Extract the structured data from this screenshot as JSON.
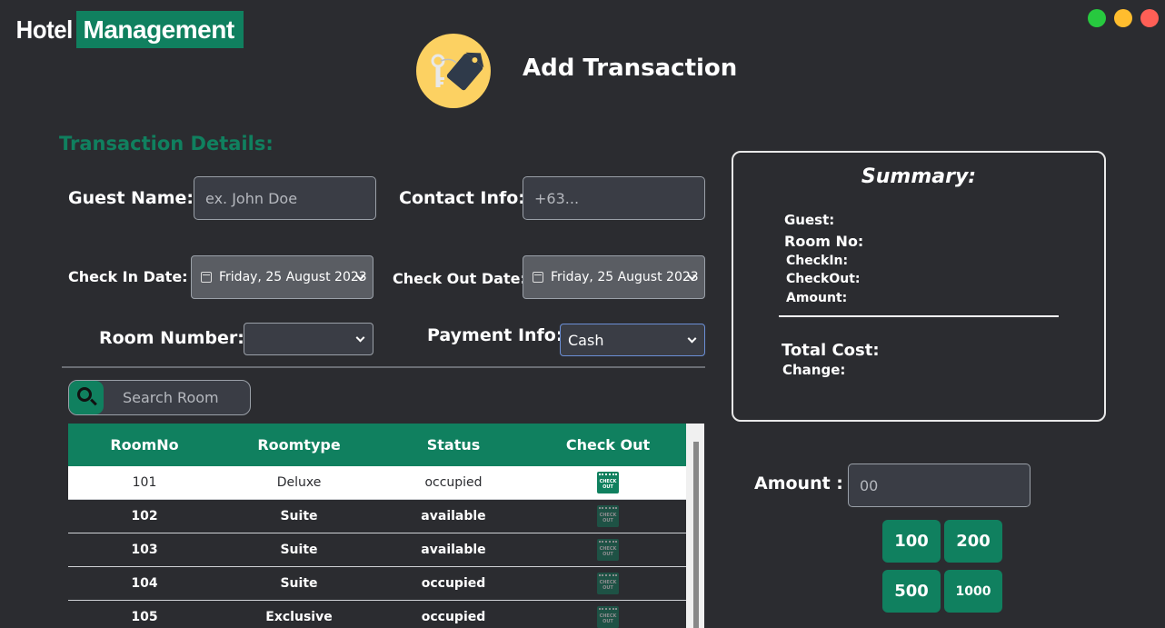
{
  "app": {
    "logo_part1": "Hotel",
    "logo_part2": "Management"
  },
  "window_controls": {
    "minimize_color": "#27c93f",
    "maximize_color": "#ffbd2e",
    "close_color": "#ff5f56"
  },
  "header": {
    "title": "Add Transaction",
    "icon": "key-tag-icon"
  },
  "form": {
    "section_title": "Transaction Details:",
    "guest_name_label": "Guest Name:",
    "guest_name_placeholder": "ex. John Doe",
    "contact_label": "Contact Info:",
    "contact_placeholder": "+63...",
    "check_in_label": "Check In Date:",
    "check_in_value": "Friday, 25 August 2023",
    "check_out_label": "Check Out Date:",
    "check_out_value": "Friday, 25 August 2023",
    "room_number_label": "Room Number:",
    "room_number_value": "",
    "payment_label": "Payment Info:",
    "payment_value": "Cash"
  },
  "search": {
    "placeholder": "Search Room"
  },
  "table": {
    "headers": [
      "RoomNo",
      "Roomtype",
      "Status",
      "Check Out"
    ],
    "checkout_icon_text": "CHECK OUT",
    "rows": [
      {
        "room": "101",
        "type": "Deluxe",
        "status": "occupied"
      },
      {
        "room": "102",
        "type": "Suite",
        "status": "available"
      },
      {
        "room": "103",
        "type": "Suite",
        "status": "available"
      },
      {
        "room": "104",
        "type": "Suite",
        "status": "occupied"
      },
      {
        "room": "105",
        "type": "Exclusive",
        "status": "occupied"
      }
    ]
  },
  "summary": {
    "title": "Summary:",
    "guest_label": "Guest:",
    "room_label": "Room No:",
    "checkin_label": "CheckIn:",
    "checkout_label": "CheckOut:",
    "amount_label": "Amount:",
    "total_label": "Total Cost:",
    "change_label": "Change:"
  },
  "payment": {
    "amount_label": "Amount :",
    "amount_placeholder": "00",
    "quick_amounts": [
      "100",
      "200",
      "500",
      "1000"
    ]
  },
  "colors": {
    "accent": "#10805f",
    "background": "#2b2c30",
    "header_icon_bg": "#fcd162"
  }
}
